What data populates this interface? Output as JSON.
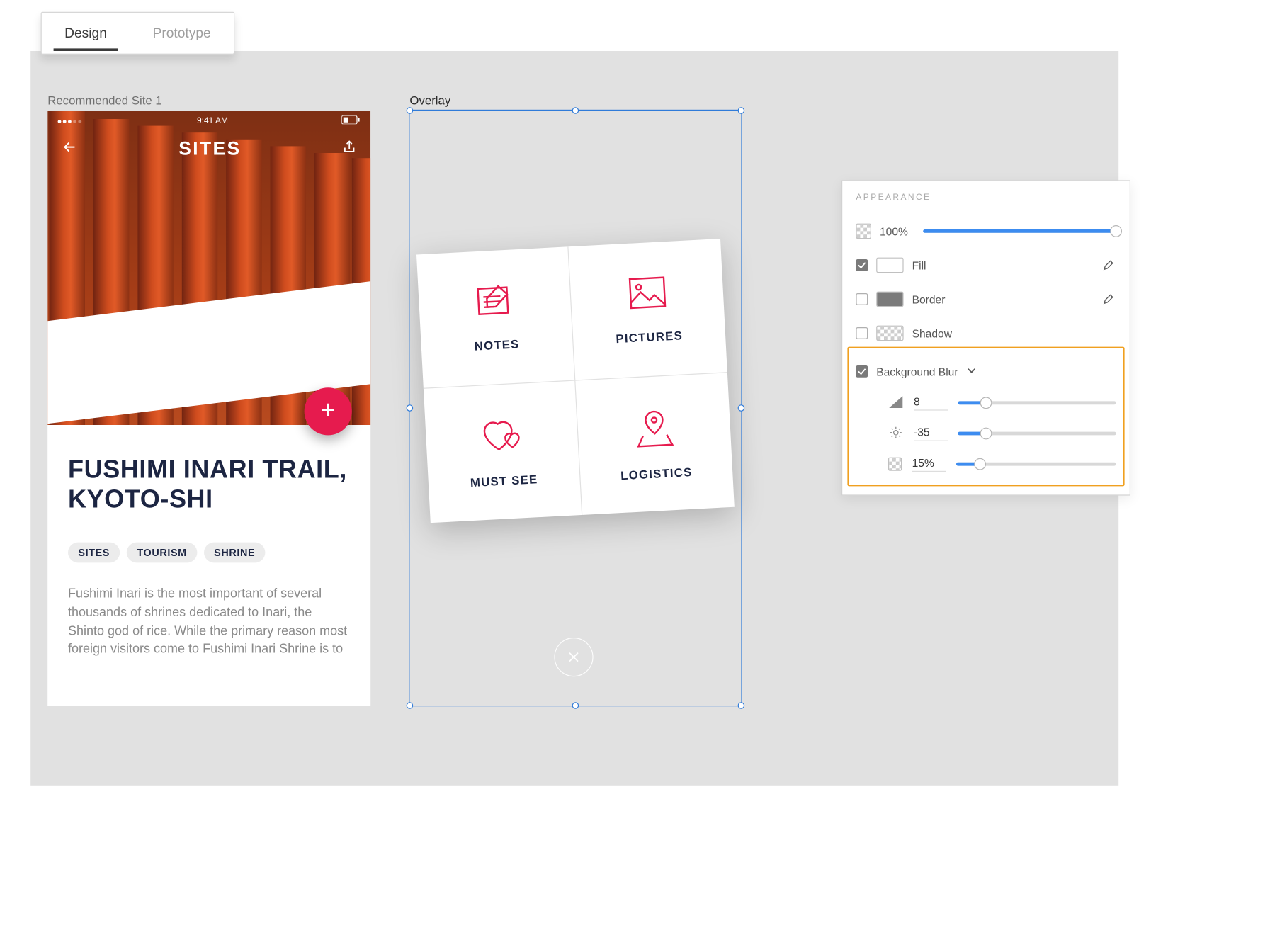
{
  "tabs": {
    "design": "Design",
    "prototype": "Prototype",
    "active": "Design"
  },
  "artboards": {
    "rec_label": "Recommended Site 1",
    "ovl_label": "Overlay"
  },
  "statusbar": {
    "time": "9:41 AM"
  },
  "nav": {
    "title": "SITES"
  },
  "site": {
    "title": "FUSHIMI INARI TRAIL,\nKYOTO-SHI",
    "tags": [
      "SITES",
      "TOURISM",
      "SHRINE"
    ],
    "description": "Fushimi Inari is the most important of several thousands of shrines dedicated to Inari, the Shinto god of rice. While the primary reason most foreign visitors come to Fushimi Inari Shrine is to"
  },
  "overlay": {
    "cells": [
      {
        "label": "NOTES",
        "icon": "notes"
      },
      {
        "label": "PICTURES",
        "icon": "pictures"
      },
      {
        "label": "MUST SEE",
        "icon": "heart"
      },
      {
        "label": "LOGISTICS",
        "icon": "pin"
      }
    ]
  },
  "inspector": {
    "title": "APPEARANCE",
    "opacity": {
      "text": "100%",
      "pct": 100
    },
    "fill": {
      "label": "Fill",
      "checked": true,
      "swatch": "#ffffff"
    },
    "border": {
      "label": "Border",
      "checked": false,
      "swatch": "#7b7b7b"
    },
    "shadow": {
      "label": "Shadow",
      "checked": false
    },
    "bgblur": {
      "label": "Background Blur",
      "checked": true,
      "amount": {
        "value": "8",
        "pct": 18
      },
      "brightness": {
        "value": "-35",
        "pct": 18
      },
      "opacity": {
        "value": "15%",
        "pct": 15
      }
    }
  }
}
